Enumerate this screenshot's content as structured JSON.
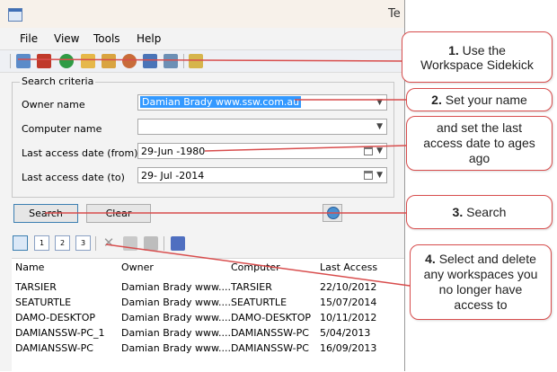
{
  "app": {
    "title_fragment": "Te"
  },
  "menu": {
    "items": [
      "File",
      "View",
      "Tools",
      "Help"
    ]
  },
  "search_criteria": {
    "legend": "Search criteria",
    "owner_name_label": "Owner name",
    "owner_name_value": "Damian Brady www.ssw.com.au",
    "computer_name_label": "Computer name",
    "computer_name_value": "",
    "last_access_from_label": "Last access date (from)",
    "last_access_from_value": "29-Jun -1980",
    "last_access_to_label": "Last access date (to)",
    "last_access_to_value": "29- Jul -2014"
  },
  "buttons": {
    "search": "Search",
    "clear": "Clear"
  },
  "view_tools": [
    "",
    "1",
    "2",
    "3"
  ],
  "table": {
    "columns": [
      "Name",
      "Owner",
      "Computer",
      "Last Access"
    ],
    "rows": [
      [
        "TARSIER",
        "Damian Brady www....",
        "TARSIER",
        "22/10/2012"
      ],
      [
        "SEATURTLE",
        "Damian Brady www....",
        "SEATURTLE",
        "15/07/2014"
      ],
      [
        "DAMO-DESKTOP",
        "Damian Brady www....",
        "DAMO-DESKTOP",
        "10/11/2012"
      ],
      [
        "DAMIANSSW-PC_1",
        "Damian Brady www....",
        "DAMIANSSW-PC",
        "5/04/2013"
      ],
      [
        "DAMIANSSW-PC",
        "Damian Brady www....",
        "DAMIANSSW-PC",
        "16/09/2013"
      ]
    ]
  },
  "callouts": {
    "c1_num": "1.",
    "c1_text_a": "Use the",
    "c1_text_b": "Workspace Sidekick",
    "c2_num": "2.",
    "c2_text": "Set your name",
    "c2b_line1": "and set the last",
    "c2b_line2": "access date to ages",
    "c2b_line3": "ago",
    "c3_num": "3.",
    "c3_text": "Search",
    "c4_num": "4.",
    "c4_line1": "Select and delete",
    "c4_line2": "any workspaces you",
    "c4_line3": "no longer have",
    "c4_line4": "access to"
  },
  "colors": {
    "accent_red": "#d84d4d",
    "selection_blue": "#3399ff"
  }
}
